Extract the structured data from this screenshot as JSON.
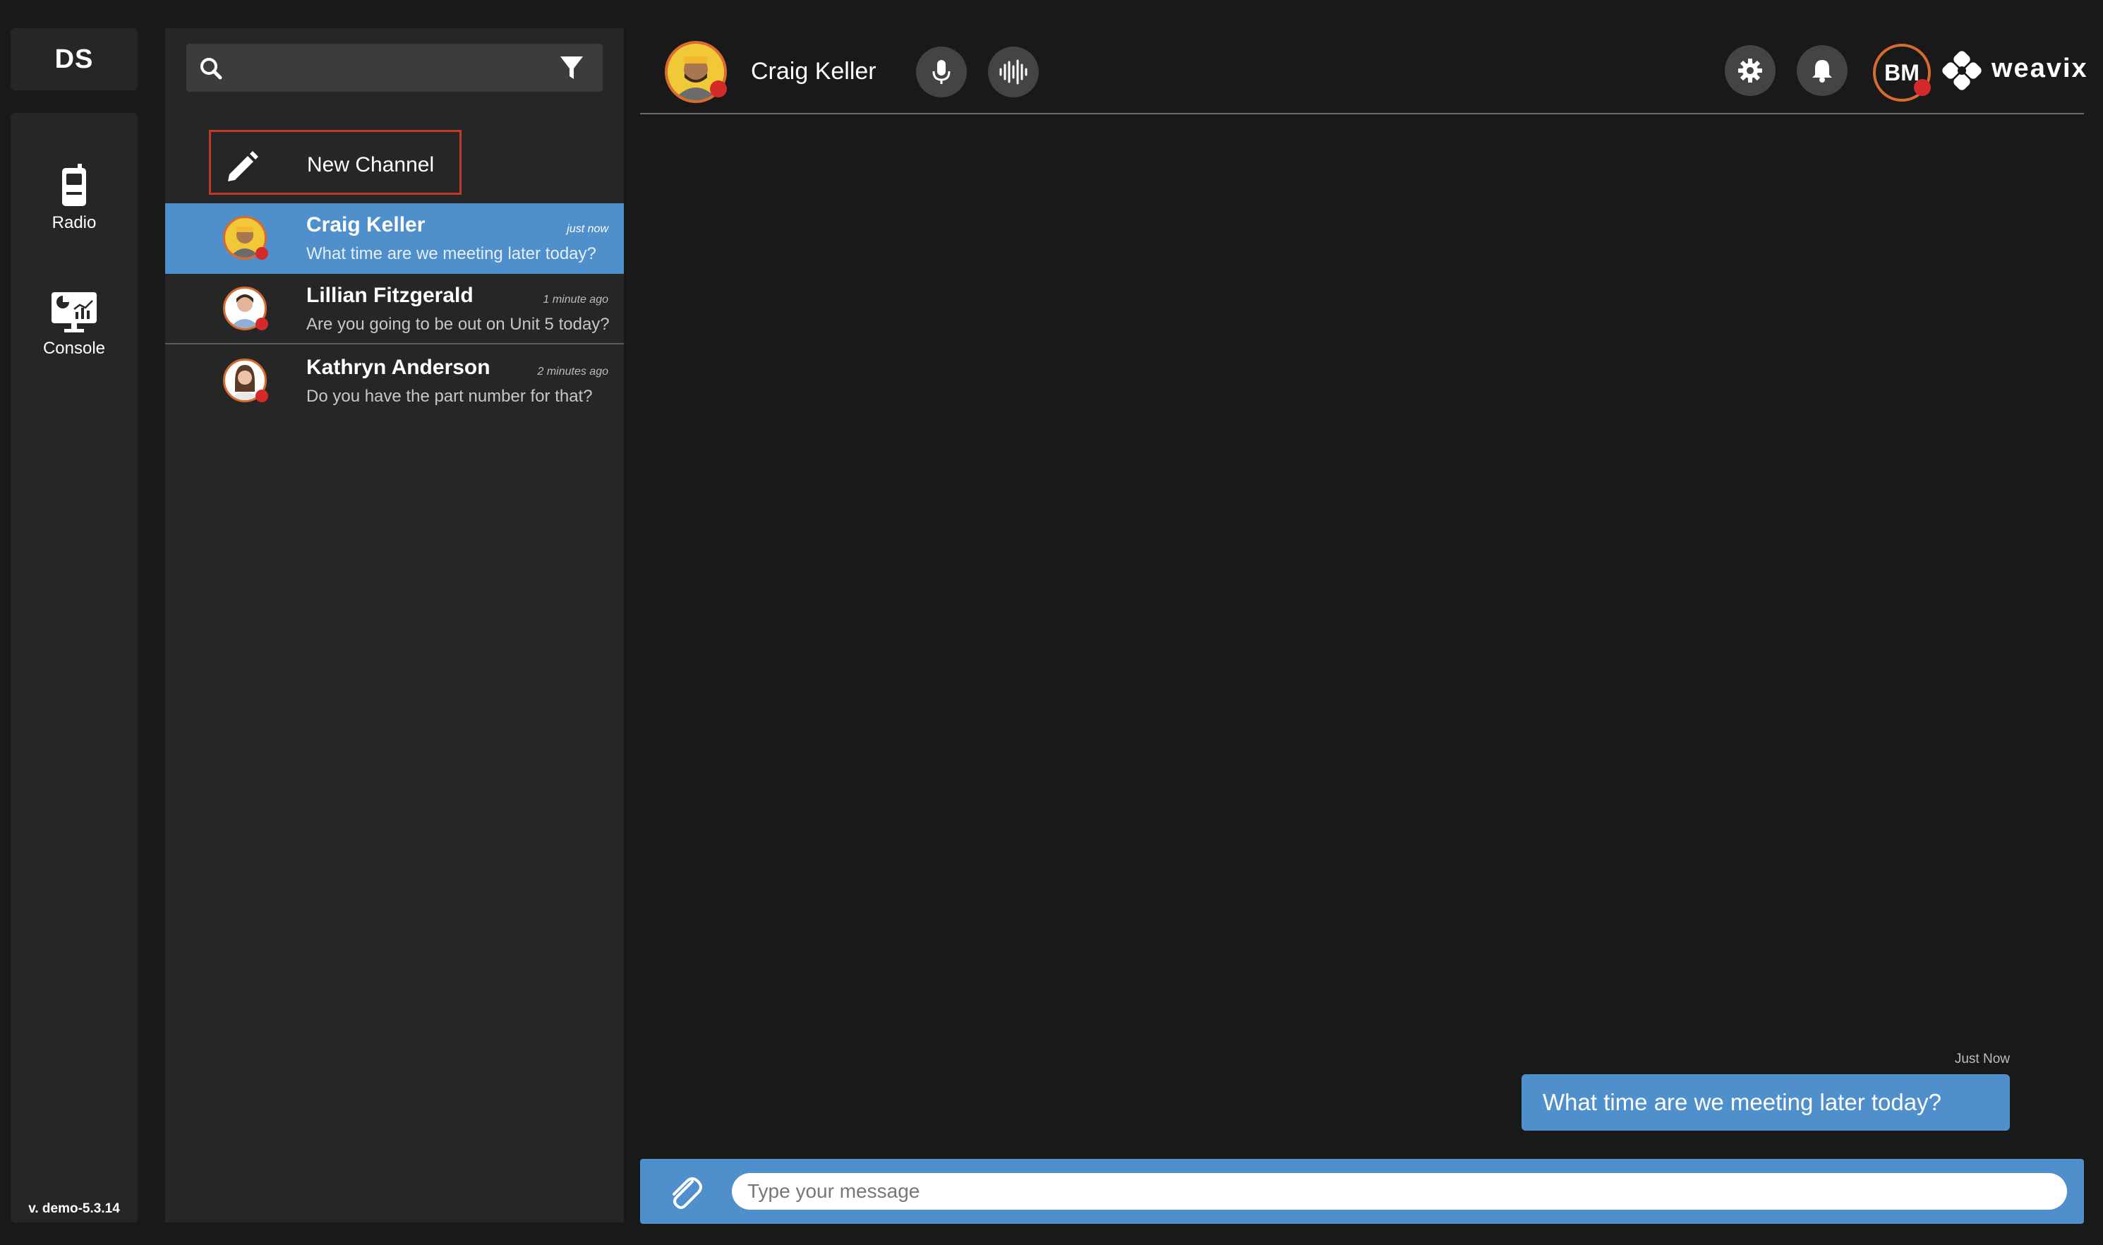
{
  "app": {
    "logo_text": "DS",
    "version": "v. demo-5.3.14",
    "brand": "weavix",
    "accent_color": "#4f8fcc",
    "status_color": "#d42a2a"
  },
  "rail": {
    "items": [
      {
        "label": "Radio",
        "icon": "radio-device-icon"
      },
      {
        "label": "Console",
        "icon": "console-monitor-icon"
      }
    ]
  },
  "channel_list": {
    "search_placeholder": "",
    "new_channel_label": "New Channel",
    "conversations": [
      {
        "name": "Craig Keller",
        "time": "just now",
        "preview": "What time are we meeting later today?",
        "selected": true
      },
      {
        "name": "Lillian Fitzgerald",
        "time": "1 minute ago",
        "preview": "Are you going to be out on Unit 5 today?",
        "selected": false
      },
      {
        "name": "Kathryn Anderson",
        "time": "2 minutes ago",
        "preview": "Do you have the part number for that?",
        "selected": false
      }
    ]
  },
  "header": {
    "contact_name": "Craig Keller",
    "user_initials": "BM"
  },
  "messages": [
    {
      "time": "Just Now",
      "text": "What time are we meeting later today?"
    }
  ],
  "composer": {
    "placeholder": "Type your message"
  }
}
